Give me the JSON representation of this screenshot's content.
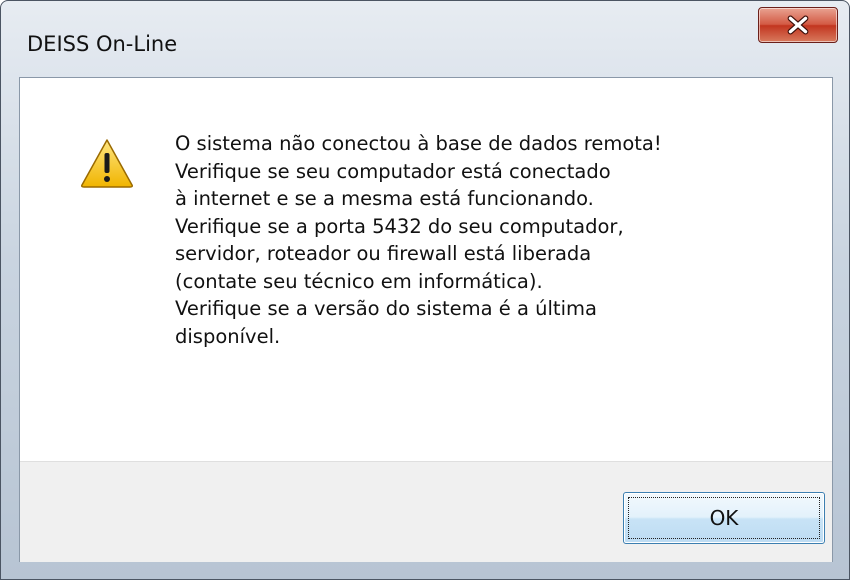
{
  "window": {
    "title": "DEISS On-Line",
    "close_icon": "close-x-icon"
  },
  "dialog": {
    "icon": "warning-triangle-icon",
    "message_lines": [
      "O sistema não conectou à base de dados remota!",
      "Verifique se seu computador está conectado",
      "à internet e se a mesma está funcionando.",
      "Verifique se a porta 5432 do seu computador,",
      "servidor, roteador ou firewall está liberada",
      "(contate seu técnico em informática).",
      "Verifique se a versão do sistema é a última",
      "disponível."
    ],
    "ok_label": "OK"
  },
  "colors": {
    "close_button": "#c2351f",
    "ok_button_border": "#3c7fb1",
    "warning_yellow": "#f5c518"
  }
}
